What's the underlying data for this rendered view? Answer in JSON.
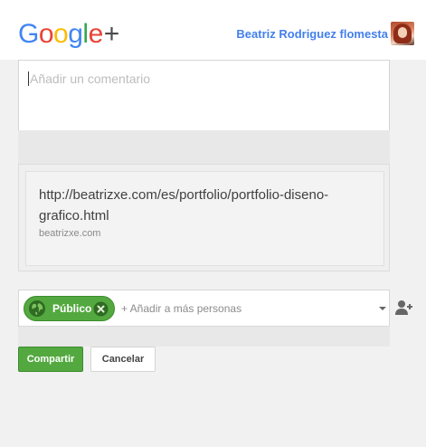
{
  "header": {
    "logo": {
      "letters": [
        "G",
        "o",
        "o",
        "g",
        "l",
        "e"
      ],
      "colors": [
        "#4285f4",
        "#ea4335",
        "#fbbc05",
        "#4285f4",
        "#34a853",
        "#ea4335"
      ],
      "plus": "+",
      "plus_color": "#4a4a4a"
    },
    "user_name": "Beatriz Rodriguez flomesta",
    "avatar_icon": "avatar-photo"
  },
  "comment": {
    "placeholder": "Añadir un comentario",
    "value": ""
  },
  "link_preview": {
    "url": "http://beatrizxe.com/es/portfolio/portfolio-diseno-grafico.html",
    "domain": "beatrizxe.com"
  },
  "share": {
    "chip_label": "Público",
    "chip_icon": "globe-icon",
    "remove_icon": "close-circle-icon",
    "add_people_placeholder": "+ Añadir a más personas",
    "dropdown_icon": "caret-down-icon",
    "add_person_icon": "add-person-icon"
  },
  "actions": {
    "share_label": "Compartir",
    "cancel_label": "Cancelar"
  },
  "colors": {
    "accent_green": "#53a93f",
    "user_link_blue": "#427fed",
    "background": "#f1f1f1"
  }
}
